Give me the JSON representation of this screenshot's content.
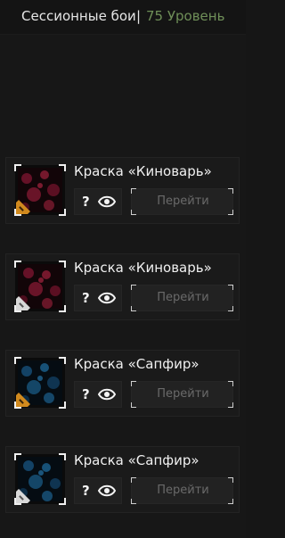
{
  "header": {
    "title": "Сессионные бои",
    "separator": "|",
    "level": "75 Уровень"
  },
  "colors": {
    "level_text": "#6f8f58",
    "rarity_gold": "#d18a1e",
    "rarity_white": "#d8d8d8",
    "vermilion": "#a0213c",
    "sapphire": "#1f6fa3"
  },
  "items": [
    {
      "title": "Краска «Киноварь»",
      "help_label": "?",
      "goto_label": "Перейти",
      "texture": "vermilion",
      "rarity": "gold",
      "eye_icon": "eye-icon"
    },
    {
      "title": "Краска «Киноварь»",
      "help_label": "?",
      "goto_label": "Перейти",
      "texture": "vermilion",
      "rarity": "white",
      "eye_icon": "eye-icon"
    },
    {
      "title": "Краска «Сапфир»",
      "help_label": "?",
      "goto_label": "Перейти",
      "texture": "sapphire",
      "rarity": "gold",
      "eye_icon": "eye-icon"
    },
    {
      "title": "Краска «Сапфир»",
      "help_label": "?",
      "goto_label": "Перейти",
      "texture": "sapphire",
      "rarity": "white",
      "eye_icon": "eye-icon"
    }
  ]
}
